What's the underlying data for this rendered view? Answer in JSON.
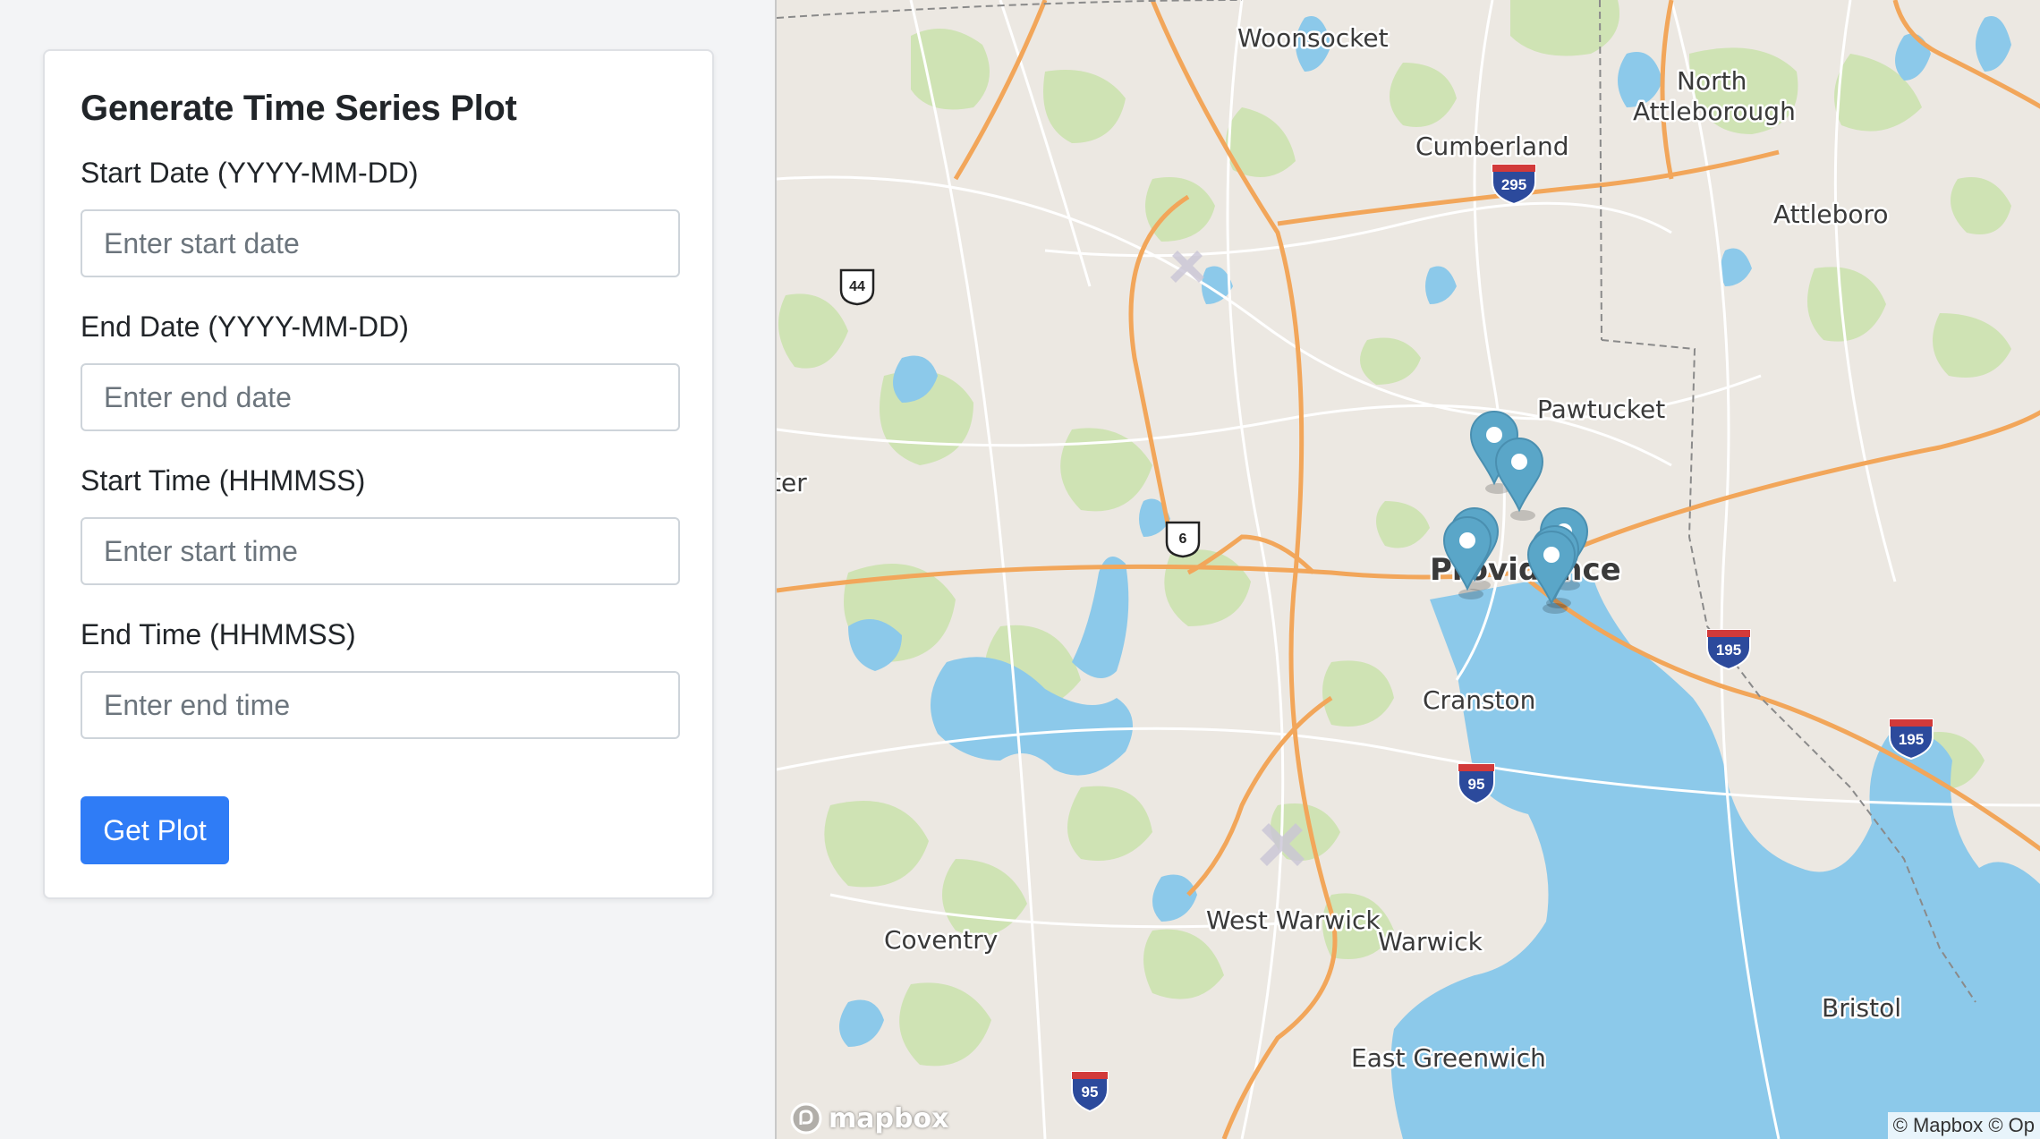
{
  "form": {
    "title": "Generate Time Series Plot",
    "fields": [
      {
        "label": "Start Date (YYYY-MM-DD)",
        "placeholder": "Enter start date",
        "value": ""
      },
      {
        "label": "End Date (YYYY-MM-DD)",
        "placeholder": "Enter end date",
        "value": ""
      },
      {
        "label": "Start Time (HHMMSS)",
        "placeholder": "Enter start time",
        "value": ""
      },
      {
        "label": "End Time (HHMMSS)",
        "placeholder": "Enter end time",
        "value": ""
      }
    ],
    "submit_label": "Get Plot"
  },
  "map": {
    "places": [
      {
        "name": "Woonsocket"
      },
      {
        "name": "North"
      },
      {
        "name": "Attleborough"
      },
      {
        "name": "Cumberland"
      },
      {
        "name": "Attleboro"
      },
      {
        "name": "Pawtucket"
      },
      {
        "name": "ter"
      },
      {
        "name": "Providence"
      },
      {
        "name": "Cranston"
      },
      {
        "name": "Coventry"
      },
      {
        "name": "West Warwick"
      },
      {
        "name": "Warwick"
      },
      {
        "name": "Bristol"
      },
      {
        "name": "East Greenwich"
      }
    ],
    "shields": [
      {
        "label": "295",
        "type": "interstate"
      },
      {
        "label": "44",
        "type": "us-route"
      },
      {
        "label": "6",
        "type": "us-route"
      },
      {
        "label": "195",
        "type": "interstate"
      },
      {
        "label": "195",
        "type": "interstate"
      },
      {
        "label": "95",
        "type": "interstate"
      },
      {
        "label": "95",
        "type": "interstate"
      }
    ],
    "markers_count": 7,
    "marker_icon": "map-pin-icon",
    "logo_text": "mapbox",
    "attribution": "© Mapbox © Op",
    "colors": {
      "land": "#ece8e2",
      "park": "#cfe3b4",
      "water": "#8cc9ea",
      "highway": "#f2a65a",
      "marker": "#5aa6c8",
      "button": "#2f7cf6"
    }
  }
}
